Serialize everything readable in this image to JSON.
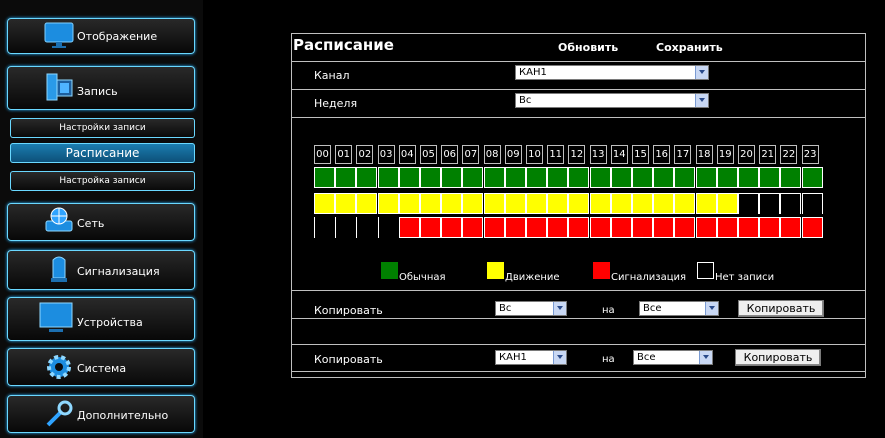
{
  "sidebar": {
    "items": [
      {
        "label": "Отображение",
        "icon": "monitor-icon"
      },
      {
        "label": "Запись",
        "icon": "film-record-icon"
      },
      {
        "sub": "Настройки записи"
      },
      {
        "sub": "Расписание"
      },
      {
        "sub": "Настройка записи"
      },
      {
        "label": "Сеть",
        "icon": "network-globe-icon"
      },
      {
        "label": "Сигнализация",
        "icon": "alarm-siren-icon"
      },
      {
        "label": "Устройства",
        "icon": "display-device-icon"
      },
      {
        "label": "Система",
        "icon": "gear-icon"
      },
      {
        "label": "Дополнительно",
        "icon": "wrench-icon"
      }
    ]
  },
  "schedule": {
    "title": "Расписание",
    "refresh_label": "Обновить",
    "save_label": "Сохранить",
    "channel_label": "Канал",
    "channel_value": "КАН1",
    "week_label": "Неделя",
    "week_value": "Вс",
    "hours": [
      "00",
      "01",
      "02",
      "03",
      "04",
      "05",
      "06",
      "07",
      "08",
      "09",
      "10",
      "11",
      "12",
      "13",
      "14",
      "15",
      "16",
      "17",
      "18",
      "19",
      "20",
      "21",
      "22",
      "23"
    ],
    "rows": {
      "normal_hours": 24,
      "motion_hours": 20,
      "alarm_start_hour": 4
    },
    "legend": {
      "normal": "Обычная",
      "motion": "Движение",
      "alarm": "Сигнализация",
      "none": "Нет записи"
    },
    "copy1": {
      "label": "Копировать",
      "from": "Вс",
      "to_label": "на",
      "to": "Все",
      "button": "Копировать"
    },
    "copy2": {
      "label": "Копировать",
      "from": "КАН1",
      "to_label": "на",
      "to": "Все",
      "button": "Копировать"
    }
  },
  "colors": {
    "normal": "#008000",
    "motion": "#ffff00",
    "alarm": "#ff0000",
    "accent": "#27b0ff"
  }
}
